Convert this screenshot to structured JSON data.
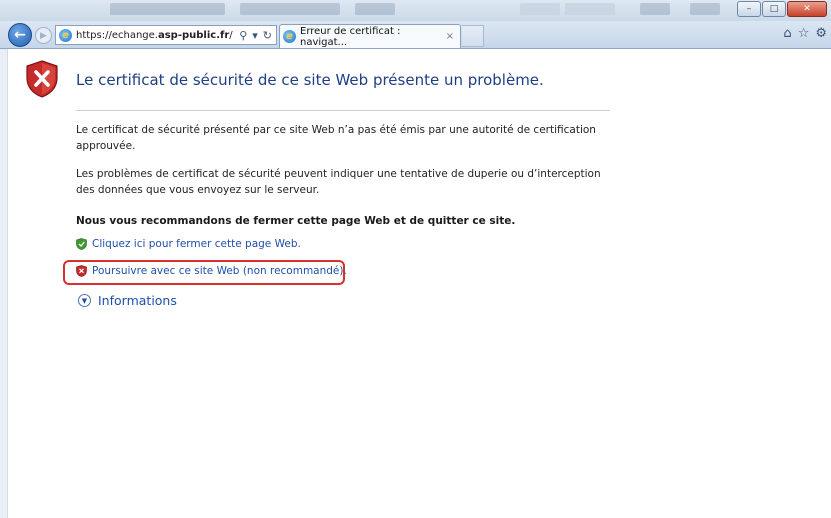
{
  "browser": {
    "address": {
      "url_prefix": "https://echange.",
      "url_host": "asp-public.fr",
      "url_suffix": "/",
      "search_icon": "search-icon",
      "refresh_icon": "refresh-icon"
    },
    "tab": {
      "title": "Erreur de certificat : navigat...",
      "close": "×"
    },
    "icons": {
      "home": "⌂",
      "favorites": "☆",
      "tools": "⚙"
    },
    "window_controls": {
      "minimize": "–",
      "maximize": "□",
      "close": "✕"
    }
  },
  "page": {
    "heading": "Le certificat de sécurité de ce site Web présente un problème.",
    "para1": "Le certificat de sécurité présenté par ce site Web n’a pas été émis par une autorité de certification approuvée.",
    "para2": "Les problèmes de certificat de sécurité peuvent indiquer une tentative de duperie ou d’interception des données que vous envoyez sur le serveur.",
    "recommend": "Nous vous recommandons de fermer cette page Web et de quitter ce site.",
    "close_link": "Cliquez ici pour fermer cette page Web.",
    "continue_link": "Poursuivre avec ce site Web (non recommandé).",
    "info_link": "Informations"
  },
  "colors": {
    "heading": "#1f3f85",
    "link": "#1f4fa8",
    "highlight": "#d9302b",
    "shield_red": "#c62a2a",
    "shield_green": "#3f9a2e"
  }
}
